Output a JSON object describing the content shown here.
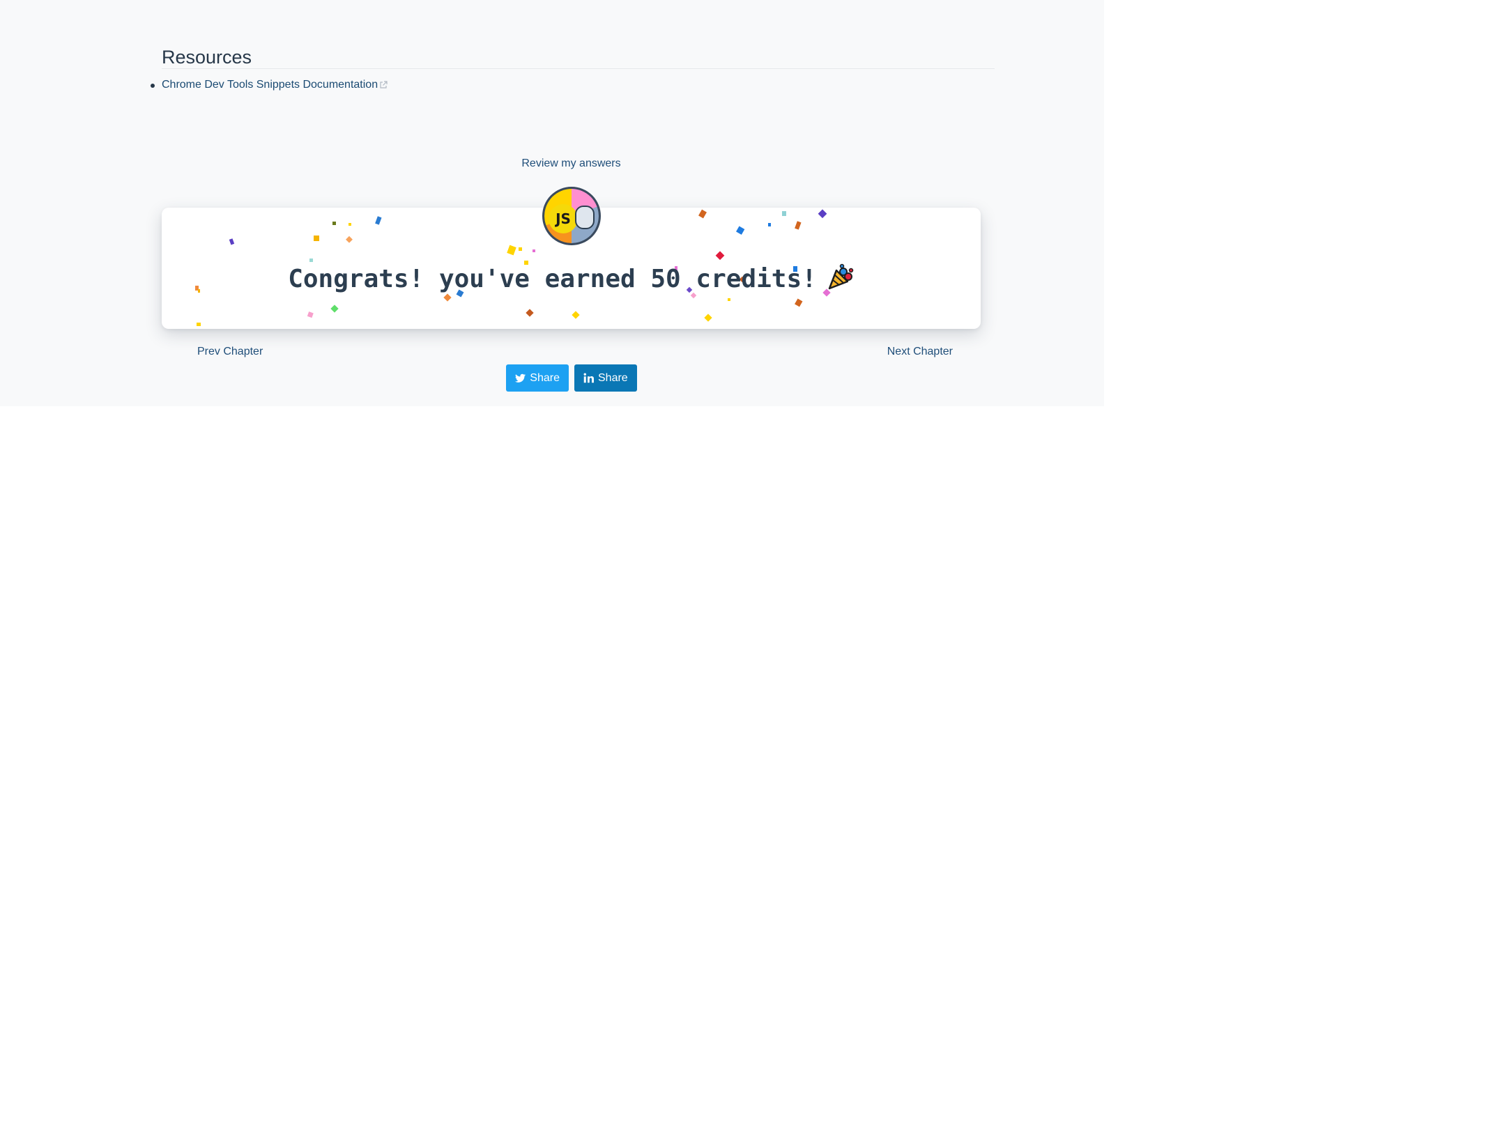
{
  "resources": {
    "title": "Resources",
    "links": [
      {
        "label": "Chrome Dev Tools Snippets Documentation",
        "icon": "external-link-icon"
      }
    ]
  },
  "review_label": "Review my answers",
  "congrats": {
    "message": "Congrats! you've earned 50 credits!",
    "badge_text": "JS",
    "celebration_icon": "party-popper-icon"
  },
  "navigation": {
    "prev_label": "Prev Chapter",
    "next_label": "Next Chapter"
  },
  "share": [
    {
      "network": "twitter",
      "label": "Share",
      "icon": "twitter-icon",
      "color": "#1da1f2"
    },
    {
      "network": "linkedin",
      "label": "Share",
      "icon": "linkedin-icon",
      "color": "#0a77b5"
    }
  ],
  "colors": {
    "page_background": "#f8f9fa",
    "text": "#273849",
    "link": "#1a4a72"
  }
}
